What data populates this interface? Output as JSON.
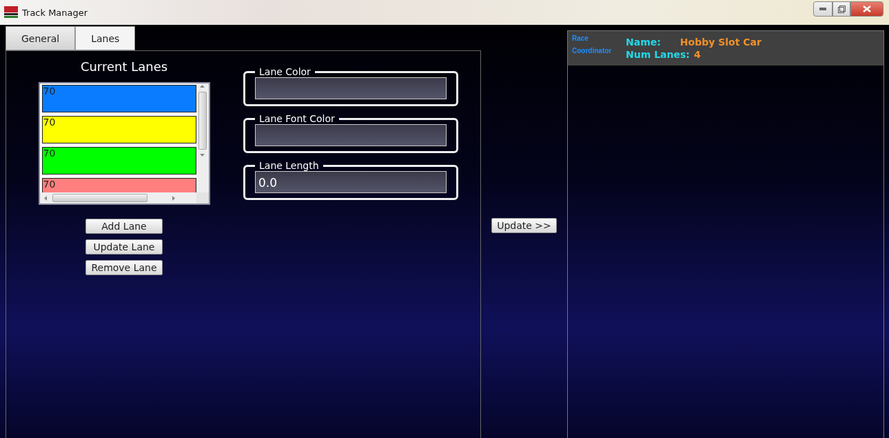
{
  "window": {
    "title": "Track Manager"
  },
  "tabs": [
    {
      "label": "General",
      "selected": false
    },
    {
      "label": "Lanes",
      "selected": true
    }
  ],
  "lanes_panel": {
    "title": "Current Lanes",
    "lanes": [
      {
        "label": "70",
        "color": "#0a7cff"
      },
      {
        "label": "70",
        "color": "#ffff00"
      },
      {
        "label": "70",
        "color": "#00ff00"
      },
      {
        "label": "70",
        "color": "#ff7f7f"
      }
    ],
    "buttons": [
      "Add Lane",
      "Update Lane",
      "Remove Lane"
    ]
  },
  "fields": [
    {
      "label": "Lane Color"
    },
    {
      "label": "Lane Font Color"
    },
    {
      "label": "Lane Length",
      "value": "0.0"
    }
  ],
  "update_button": "Update >>",
  "info": {
    "logo_top": "Race",
    "logo_bottom": "Coordinator",
    "name_label": "Name:",
    "name_value": "Hobby Slot Car",
    "lanes_label": "Num Lanes:",
    "lanes_value": "4"
  }
}
